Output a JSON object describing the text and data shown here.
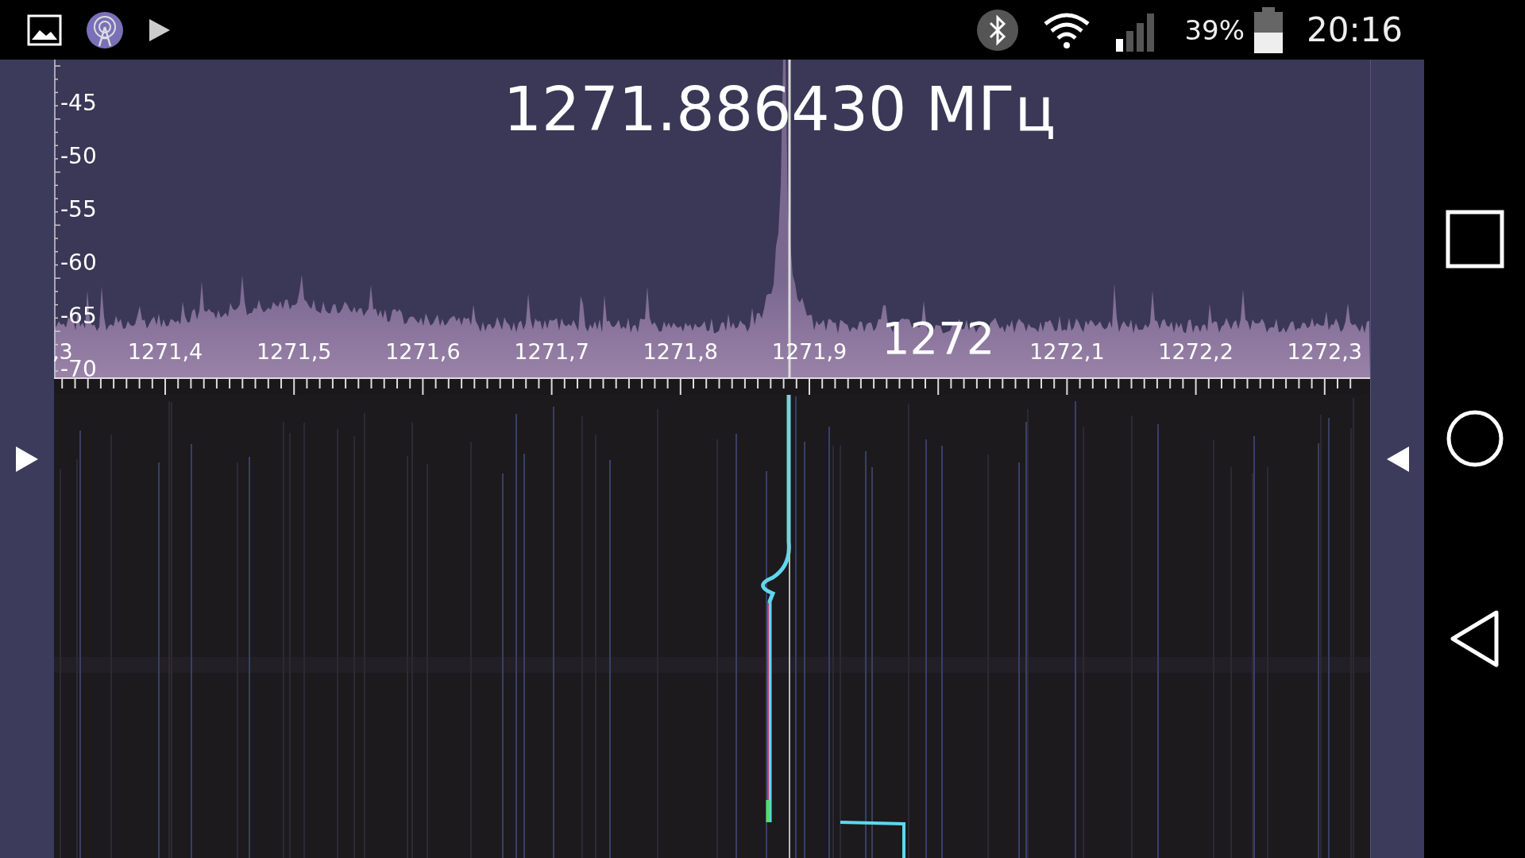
{
  "status_bar": {
    "battery": "39%",
    "time": "20:16"
  },
  "spectrum": {
    "frequency": "1271.886430 МГц",
    "y_labels": [
      "-45",
      "-50",
      "-55",
      "-60",
      "-65",
      "-70"
    ],
    "x_labels": [
      {
        "text": ",3",
        "kind": "cut"
      },
      {
        "text": "1271,4",
        "kind": "minor"
      },
      {
        "text": "1271,5",
        "kind": "minor"
      },
      {
        "text": "1271,6",
        "kind": "minor"
      },
      {
        "text": "1271,7",
        "kind": "minor"
      },
      {
        "text": "1271,8",
        "kind": "minor"
      },
      {
        "text": "1271,9",
        "kind": "minor"
      },
      {
        "text": "1272",
        "kind": "major"
      },
      {
        "text": "1272,1",
        "kind": "minor"
      },
      {
        "text": "1272,2",
        "kind": "minor"
      },
      {
        "text": "1272,3",
        "kind": "minor"
      }
    ]
  }
}
